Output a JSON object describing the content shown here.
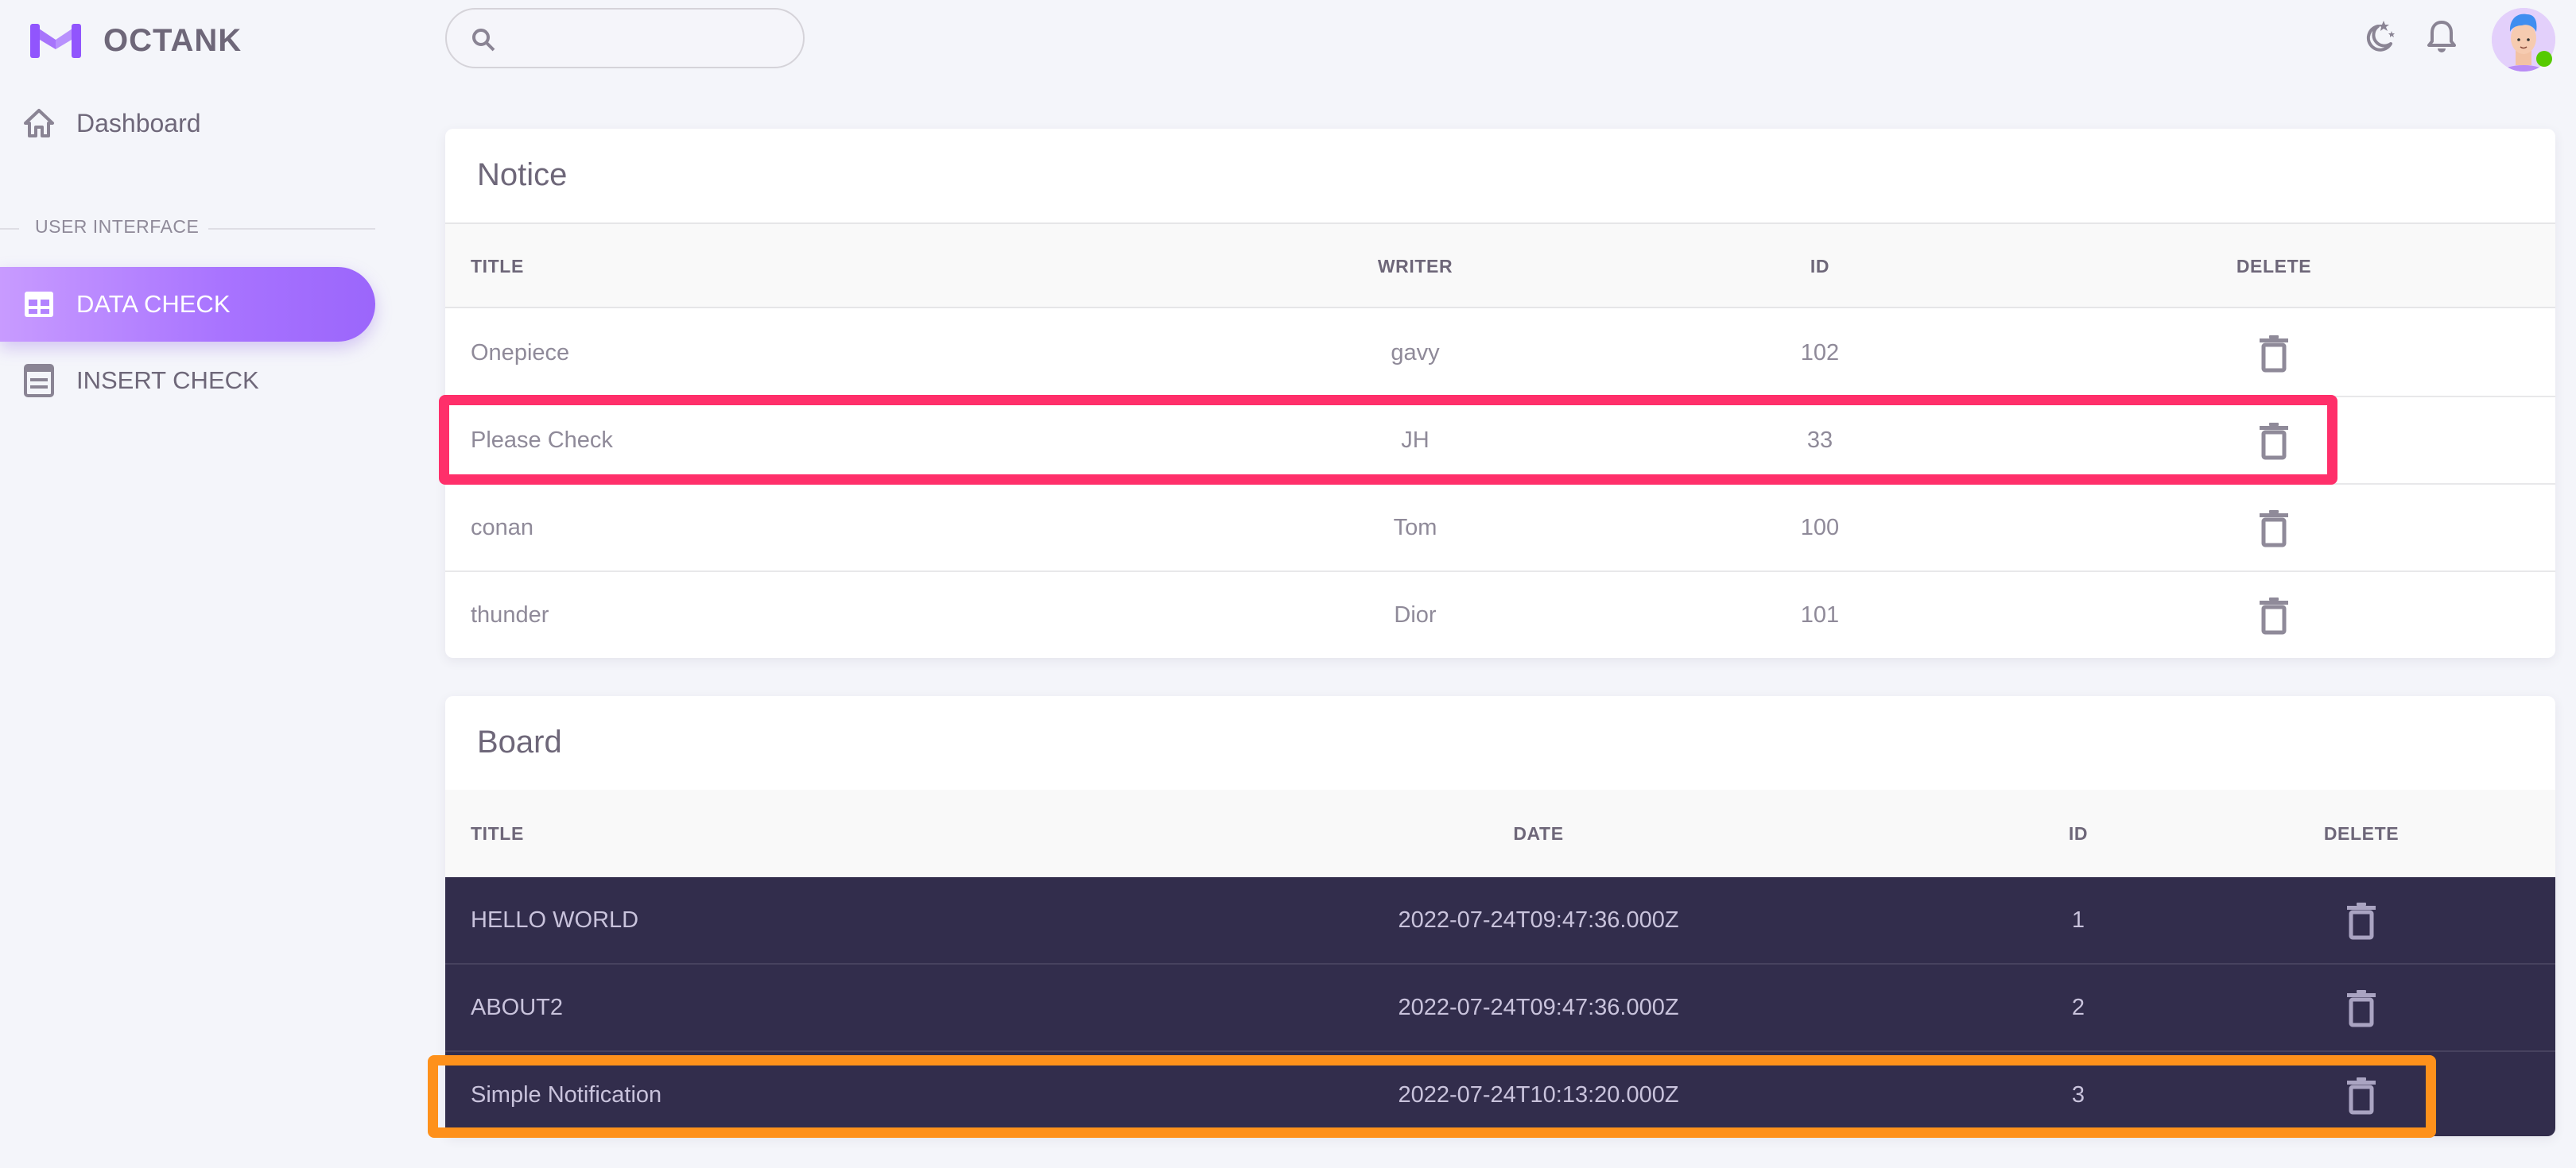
{
  "brand": {
    "name": "OCTANK",
    "accent": "#9155fd"
  },
  "sidebar": {
    "items": [
      {
        "label": "Dashboard",
        "icon": "home-icon",
        "active": false
      },
      {
        "label": "DATA CHECK",
        "icon": "table-icon",
        "active": true
      },
      {
        "label": "INSERT CHECK",
        "icon": "form-icon",
        "active": false
      }
    ],
    "section_label": "USER INTERFACE"
  },
  "topbar": {
    "search": {
      "value": "",
      "placeholder": ""
    },
    "icons": [
      "theme-toggle-icon",
      "notification-bell-icon"
    ],
    "user_status": "online"
  },
  "notice": {
    "title": "Notice",
    "columns": [
      "TITLE",
      "WRITER",
      "ID",
      "DELETE"
    ],
    "rows": [
      {
        "title": "Onepiece",
        "writer": "gavy",
        "id": "102"
      },
      {
        "title": "Please Check",
        "writer": "JH",
        "id": "33",
        "highlight": "#ff2f6a"
      },
      {
        "title": "conan",
        "writer": "Tom",
        "id": "100"
      },
      {
        "title": "thunder",
        "writer": "Dior",
        "id": "101"
      }
    ]
  },
  "board": {
    "title": "Board",
    "columns": [
      "TITLE",
      "DATE",
      "ID",
      "DELETE"
    ],
    "rows": [
      {
        "title": "HELLO WORLD",
        "date": "2022-07-24T09:47:36.000Z",
        "id": "1"
      },
      {
        "title": "ABOUT2",
        "date": "2022-07-24T09:47:36.000Z",
        "id": "2"
      },
      {
        "title": "Simple Notification",
        "date": "2022-07-24T10:13:20.000Z",
        "id": "3",
        "highlight": "#fe911b"
      }
    ]
  }
}
